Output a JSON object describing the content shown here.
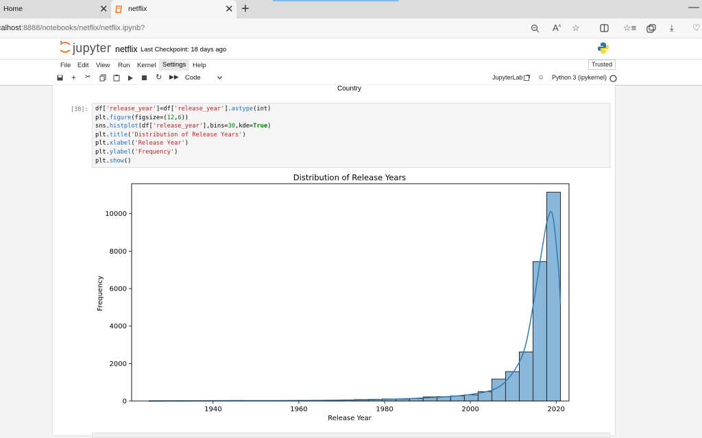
{
  "browser": {
    "tabs": [
      {
        "title": "Home",
        "close": "✕"
      },
      {
        "title": "netflix",
        "close": "✕"
      }
    ],
    "new_tab": "+",
    "minimize": "—",
    "url_host": "calhost",
    "url_rest": ":8888/notebooks/netflix/netflix.ipynb?",
    "toolbar_icons": [
      "zoom-icon",
      "read-aloud-icon",
      "favorite-icon",
      "split-screen-icon",
      "favorites-list-icon",
      "collections-icon",
      "download-icon",
      "extensions-icon"
    ]
  },
  "jupyter": {
    "logo_text": "jupyter",
    "notebook_name": "netflix",
    "checkpoint": "Last Checkpoint: 18 days ago",
    "menu": [
      "File",
      "Edit",
      "View",
      "Run",
      "Kernel",
      "Settings",
      "Help"
    ],
    "trusted": "Trusted",
    "cell_type": "Code",
    "jupyterlab_link": "JupyterLab",
    "kernel": "Python 3 (ipykernel)"
  },
  "notebook": {
    "prev_output_label": "Country",
    "cell_prompt": "[38]:",
    "code_lines": [
      "df['release_year']=df['release_year'].astype(int)",
      "plt.figure(figsize=(12,6))",
      "sns.histplot(df['release_year'],bins=30,kde=True)",
      "plt.title('Distribution of Release Years')",
      "plt.xlabel('Release Year')",
      "plt.ylabel('Frequency')",
      "plt.show()"
    ]
  },
  "colors": {
    "bar_fill": "#89b7d9",
    "bar_edge": "#1a1a1a",
    "kde_line": "#2f7ab1",
    "jupyter_orange": "#f37726"
  },
  "chart_data": {
    "type": "bar",
    "title": "Distribution of Release Years",
    "xlabel": "Release Year",
    "ylabel": "Frequency",
    "xlim": [
      1921,
      2023
    ],
    "ylim": [
      0,
      11600
    ],
    "xticks": [
      1940,
      1960,
      1980,
      2000,
      2020
    ],
    "yticks": [
      0,
      2000,
      4000,
      6000,
      8000,
      10000
    ],
    "bins": [
      {
        "x0": 1925.0,
        "x1": 1928.2,
        "value": 2
      },
      {
        "x0": 1928.2,
        "x1": 1931.4,
        "value": 5
      },
      {
        "x0": 1931.4,
        "x1": 1934.6,
        "value": 4
      },
      {
        "x0": 1934.6,
        "x1": 1937.8,
        "value": 6
      },
      {
        "x0": 1937.8,
        "x1": 1941.0,
        "value": 8
      },
      {
        "x0": 1941.0,
        "x1": 1944.2,
        "value": 20
      },
      {
        "x0": 1944.2,
        "x1": 1947.4,
        "value": 25
      },
      {
        "x0": 1947.4,
        "x1": 1950.6,
        "value": 10
      },
      {
        "x0": 1950.6,
        "x1": 1953.8,
        "value": 10
      },
      {
        "x0": 1953.8,
        "x1": 1957.0,
        "value": 15
      },
      {
        "x0": 1957.0,
        "x1": 1960.2,
        "value": 20
      },
      {
        "x0": 1960.2,
        "x1": 1963.4,
        "value": 25
      },
      {
        "x0": 1963.4,
        "x1": 1966.6,
        "value": 30
      },
      {
        "x0": 1966.6,
        "x1": 1969.8,
        "value": 40
      },
      {
        "x0": 1969.8,
        "x1": 1973.0,
        "value": 60
      },
      {
        "x0": 1973.0,
        "x1": 1976.2,
        "value": 80
      },
      {
        "x0": 1976.2,
        "x1": 1979.4,
        "value": 90
      },
      {
        "x0": 1979.4,
        "x1": 1982.6,
        "value": 110
      },
      {
        "x0": 1982.6,
        "x1": 1985.8,
        "value": 100
      },
      {
        "x0": 1985.8,
        "x1": 1989.0,
        "value": 130
      },
      {
        "x0": 1989.0,
        "x1": 1992.2,
        "value": 220
      },
      {
        "x0": 1992.2,
        "x1": 1995.4,
        "value": 230
      },
      {
        "x0": 1995.4,
        "x1": 1998.6,
        "value": 270
      },
      {
        "x0": 1998.6,
        "x1": 2001.8,
        "value": 330
      },
      {
        "x0": 2001.8,
        "x1": 2005.0,
        "value": 500
      },
      {
        "x0": 2005.0,
        "x1": 2008.2,
        "value": 1170
      },
      {
        "x0": 2008.2,
        "x1": 2011.4,
        "value": 1570
      },
      {
        "x0": 2011.4,
        "x1": 2014.6,
        "value": 2620
      },
      {
        "x0": 2014.6,
        "x1": 2017.8,
        "value": 7440
      },
      {
        "x0": 2017.8,
        "x1": 2021.0,
        "value": 11150
      }
    ],
    "kde": {
      "x": [
        1925,
        1935,
        1945,
        1955,
        1965,
        1975,
        1985,
        1990,
        1995,
        2000,
        2005,
        2008,
        2011,
        2013,
        2015,
        2016.5,
        2018,
        2019.2,
        2020.5,
        2021
      ],
      "y": [
        5,
        10,
        20,
        20,
        30,
        60,
        120,
        170,
        240,
        350,
        580,
        1000,
        1900,
        3100,
        5600,
        7800,
        9700,
        9900,
        7200,
        5200
      ]
    }
  }
}
